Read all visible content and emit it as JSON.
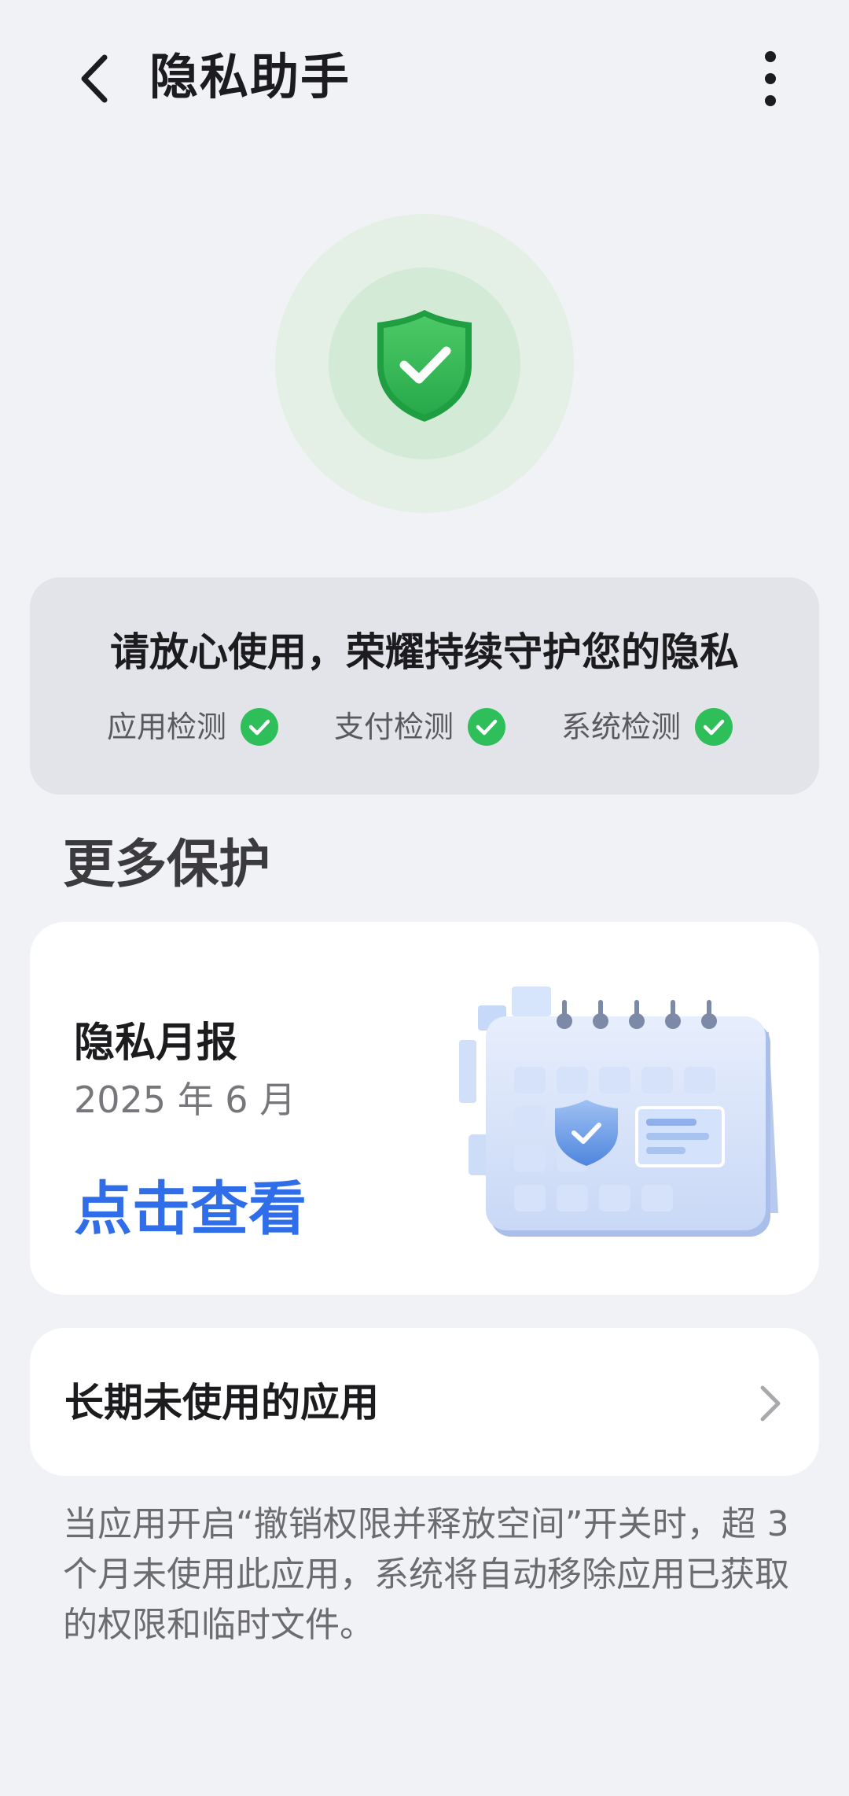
{
  "header": {
    "title": "隐私助手",
    "back_icon": "chevron-left-icon",
    "more_icon": "more-vertical-icon"
  },
  "hero": {
    "icon": "shield-check-icon",
    "colors": {
      "shield": "#33bd59",
      "halo_outer": "#e4f0e6",
      "halo_inner": "#d3ead7"
    }
  },
  "status": {
    "title": "请放心使用，荣耀持续守护您的隐私",
    "checks": [
      {
        "label": "应用检测",
        "icon": "check-circle-icon"
      },
      {
        "label": "支付检测",
        "icon": "check-circle-icon"
      },
      {
        "label": "系统检测",
        "icon": "check-circle-icon"
      }
    ]
  },
  "more_protection": {
    "title": "更多保护",
    "report": {
      "title": "隐私月报",
      "date": "2025 年 6 月",
      "link_label": "点击查看",
      "illustration": "calendar-shield-illustration"
    },
    "unused_apps": {
      "label": "长期未使用的应用",
      "icon": "chevron-right-icon"
    },
    "footnote": "当应用开启“撤销权限并释放空间”开关时，超 3 个月未使用此应用，系统将自动移除应用已获取的权限和临时文件。"
  },
  "colors": {
    "background": "#f1f2f6",
    "accent_link": "#2f6ee8",
    "check_green": "#2fbf5a"
  }
}
